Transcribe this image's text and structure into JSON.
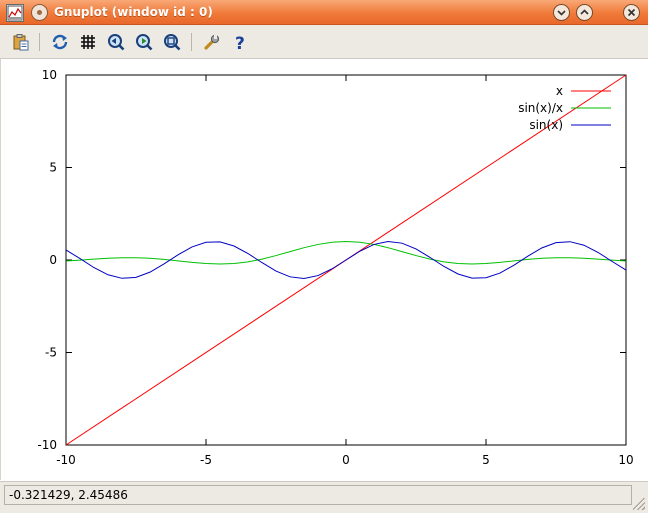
{
  "window": {
    "title": "Gnuplot (window id : 0)"
  },
  "toolbar": {
    "buttons": [
      {
        "name": "copy-clipboard-button",
        "icon": "clipboard-icon"
      },
      {
        "name": "replot-button",
        "icon": "refresh-icon"
      },
      {
        "name": "grid-button",
        "icon": "grid-icon"
      },
      {
        "name": "previous-zoom-button",
        "icon": "zoom-prev-icon"
      },
      {
        "name": "next-zoom-button",
        "icon": "zoom-next-icon"
      },
      {
        "name": "autoscale-button",
        "icon": "autoscale-icon"
      },
      {
        "name": "options-button",
        "icon": "wrench-icon"
      },
      {
        "name": "help-button",
        "icon": "help-icon"
      }
    ]
  },
  "status": {
    "text": "-0.321429,  2.45486"
  },
  "chart_data": {
    "type": "line",
    "xlim": [
      -10,
      10
    ],
    "ylim": [
      -10,
      10
    ],
    "x_ticks": [
      "-10",
      "-5",
      "0",
      "5",
      "10"
    ],
    "y_ticks": [
      "10",
      "5",
      "0",
      "-5",
      "-10"
    ],
    "grid": false,
    "legend_position": "top-right",
    "series": [
      {
        "name": "x",
        "color": "#ff0000",
        "x": [
          -10,
          10
        ],
        "y": [
          -10,
          10
        ]
      },
      {
        "name": "sin(x)/x",
        "color": "#00c000",
        "x": [
          -10,
          -9.5,
          -9,
          -8.5,
          -8,
          -7.5,
          -7,
          -6.5,
          -6,
          -5.5,
          -5,
          -4.5,
          -4,
          -3.5,
          -3,
          -2.5,
          -2,
          -1.5,
          -1,
          -0.5,
          0,
          0.5,
          1,
          1.5,
          2,
          2.5,
          3,
          3.5,
          4,
          4.5,
          5,
          5.5,
          6,
          6.5,
          7,
          7.5,
          8,
          8.5,
          9,
          9.5,
          10
        ],
        "y": [
          -0.054,
          -0.0079,
          0.0458,
          0.0941,
          0.1237,
          0.125,
          0.0939,
          0.033,
          -0.0466,
          -0.1283,
          -0.1918,
          -0.2172,
          -0.1892,
          -0.1002,
          0.047,
          0.2394,
          0.4546,
          0.665,
          0.8415,
          0.9589,
          1.0,
          0.9589,
          0.8415,
          0.665,
          0.4546,
          0.2394,
          0.047,
          -0.1002,
          -0.1892,
          -0.2172,
          -0.1918,
          -0.1283,
          -0.0466,
          0.033,
          0.0939,
          0.125,
          0.1237,
          0.0941,
          0.0458,
          -0.0079,
          -0.054
        ]
      },
      {
        "name": "sin(x)",
        "color": "#0000c0",
        "x": [
          -10,
          -9.5,
          -9,
          -8.5,
          -8,
          -7.5,
          -7,
          -6.5,
          -6,
          -5.5,
          -5,
          -4.5,
          -4,
          -3.5,
          -3,
          -2.5,
          -2,
          -1.5,
          -1,
          -0.5,
          0,
          0.5,
          1,
          1.5,
          2,
          2.5,
          3,
          3.5,
          4,
          4.5,
          5,
          5.5,
          6,
          6.5,
          7,
          7.5,
          8,
          8.5,
          9,
          9.5,
          10
        ],
        "y": [
          0.544,
          0.0752,
          -0.4121,
          -0.7985,
          -0.9894,
          -0.938,
          -0.657,
          -0.2151,
          0.2794,
          0.7055,
          0.9589,
          0.9775,
          0.7568,
          0.3508,
          -0.1411,
          -0.5985,
          -0.9093,
          -0.9975,
          -0.8415,
          -0.4794,
          0,
          0.4794,
          0.8415,
          0.9975,
          0.9093,
          0.5985,
          0.1411,
          -0.3508,
          -0.7568,
          -0.9775,
          -0.9589,
          -0.7055,
          -0.2794,
          0.2151,
          0.657,
          0.938,
          0.9894,
          0.7985,
          0.4121,
          -0.0752,
          -0.544
        ]
      }
    ]
  }
}
